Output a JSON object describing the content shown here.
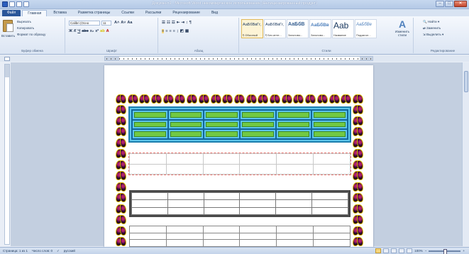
{
  "window": {
    "title": "Документ1 - Microsoft Word некоммерческое использование (Нелицензированный продукт)",
    "controls": [
      "–",
      "□",
      "✕"
    ]
  },
  "tabs": [
    "Файл",
    "Главная",
    "Вставка",
    "Разметка страницы",
    "Ссылки",
    "Рассылки",
    "Рецензирование",
    "Вид"
  ],
  "clipboard": {
    "paste_label": "Вставить",
    "cut_label": "Вырезать",
    "copy_label": "Копировать",
    "format_painter_label": "Формат по образцу",
    "group_label": "Буфер обмена"
  },
  "font": {
    "font_name": "Calibri (Осно",
    "font_size": "11",
    "group_label": "Шрифт"
  },
  "paragraph": {
    "group_label": "Абзац"
  },
  "styles": {
    "items": [
      {
        "sample": "АаБбВвГг,",
        "name": "¶ Обычный"
      },
      {
        "sample": "АаБбВвГг,",
        "name": "¶ Без инте..."
      },
      {
        "sample": "АаБбВ",
        "name": "Заголово..."
      },
      {
        "sample": "АаБбВв",
        "name": "Заголово..."
      },
      {
        "sample": "Aab",
        "name": "Название"
      },
      {
        "sample": "АаБбВе",
        "name": "Подзагол..."
      }
    ],
    "change_styles_label": "Изменить стили",
    "group_label": "Стили"
  },
  "editing": {
    "find_label": "Найти",
    "replace_label": "Заменить",
    "select_label": "Выделить",
    "group_label": "Редактирование"
  },
  "status": {
    "page": "Страница: 1 из 1",
    "words": "Число слов: 0",
    "language": "русский",
    "zoom": "100%"
  },
  "tables": {
    "table1": {
      "rows": 3,
      "cols": 6
    },
    "table2": {
      "rows": 2,
      "cols": 6
    },
    "table3": {
      "rows": 3,
      "cols": 6
    },
    "table4": {
      "rows": 3,
      "cols": 6
    }
  },
  "colors": {
    "table1_fill": "#5cc4ea",
    "table1_cells": "#71c944",
    "ribbon": "#dbe5f3",
    "file_tab": "#2a5699"
  }
}
